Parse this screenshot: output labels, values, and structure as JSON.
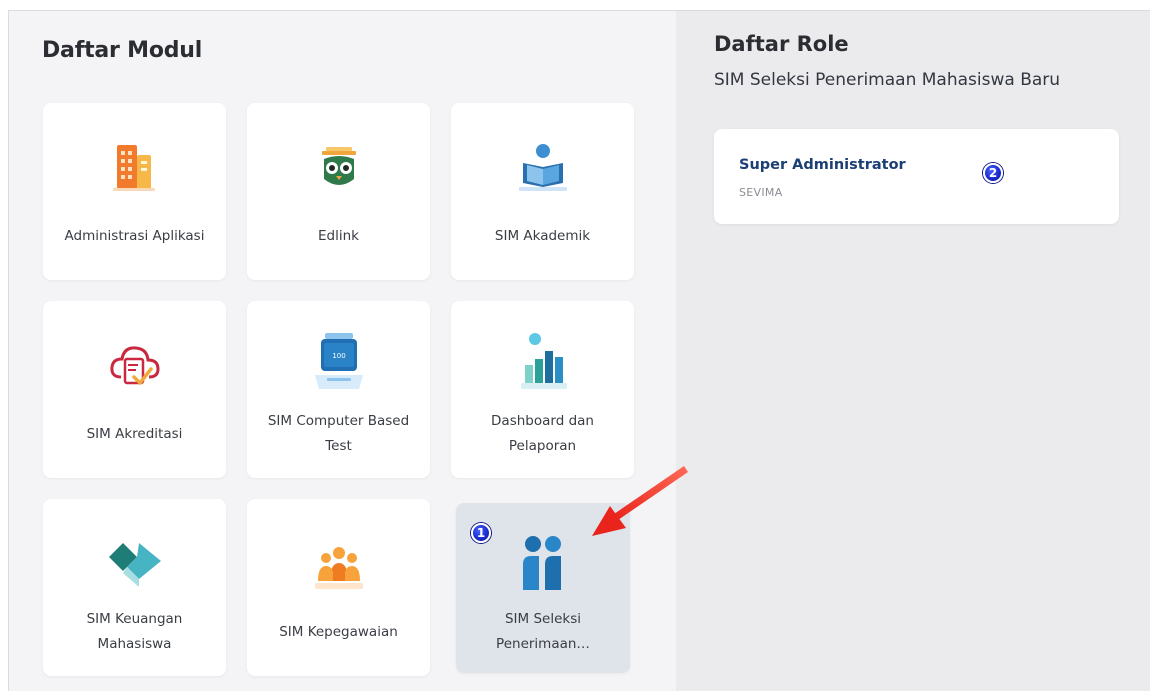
{
  "modules_panel": {
    "title": "Daftar Modul",
    "modules": [
      {
        "label": "Administrasi Aplikasi",
        "icon": "building-icon"
      },
      {
        "label": "Edlink",
        "icon": "owl-icon"
      },
      {
        "label": "SIM Akademik",
        "icon": "reading-person-icon"
      },
      {
        "label": "SIM Akreditasi",
        "icon": "cloud-certificate-icon"
      },
      {
        "label": "SIM Computer Based Test",
        "icon": "monitor-score-icon"
      },
      {
        "label": "Dashboard dan Pelaporan",
        "icon": "bar-chart-icon"
      },
      {
        "label": "SIM Keuangan Mahasiswa",
        "icon": "diamond-icon"
      },
      {
        "label": "SIM Kepegawaian",
        "icon": "people-group-icon"
      },
      {
        "label": "SIM Seleksi Penerimaan…",
        "icon": "two-people-icon"
      }
    ],
    "selected_badge": "1"
  },
  "roles_panel": {
    "title": "Daftar Role",
    "subtitle": "SIM Seleksi Penerimaan Mahasiswa Baru",
    "roles": [
      {
        "name": "Super Administrator",
        "org": "SEVIMA"
      }
    ],
    "role_badge": "2"
  },
  "colors": {
    "left_panel_bg": "#f4f4f6",
    "right_panel_bg": "#ebebed",
    "card_bg": "#ffffff",
    "selected_card_bg": "#dfe3ea",
    "role_name": "#1c3f74",
    "badge": "#1b2ccf",
    "arrow": "#e8241c"
  }
}
